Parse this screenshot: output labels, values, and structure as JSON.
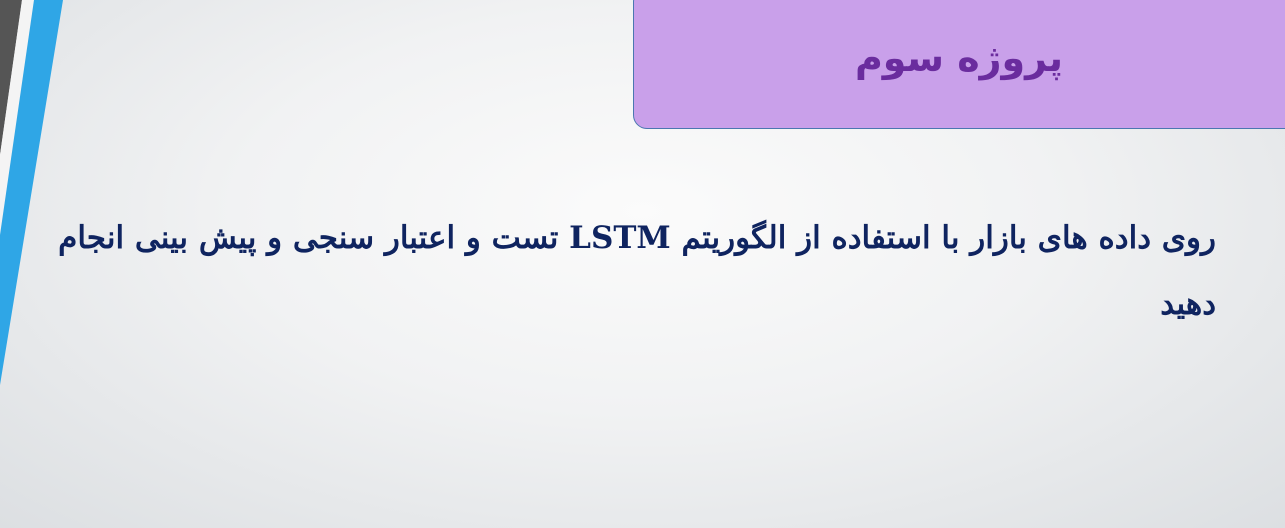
{
  "slide": {
    "title": "پروژه سوم",
    "body": "روی داده های بازار با استفاده از الگوریتم LSTM تست و اعتبار سنجی و پیش بینی انجام دهید"
  },
  "colors": {
    "title_box_fill": "#c9a0ea",
    "title_box_border": "#4b77b0",
    "title_text": "#6a2c9e",
    "body_text": "#0f2460",
    "accent_stripe": "#2fa6e6",
    "dark_stripe": "#555555"
  }
}
